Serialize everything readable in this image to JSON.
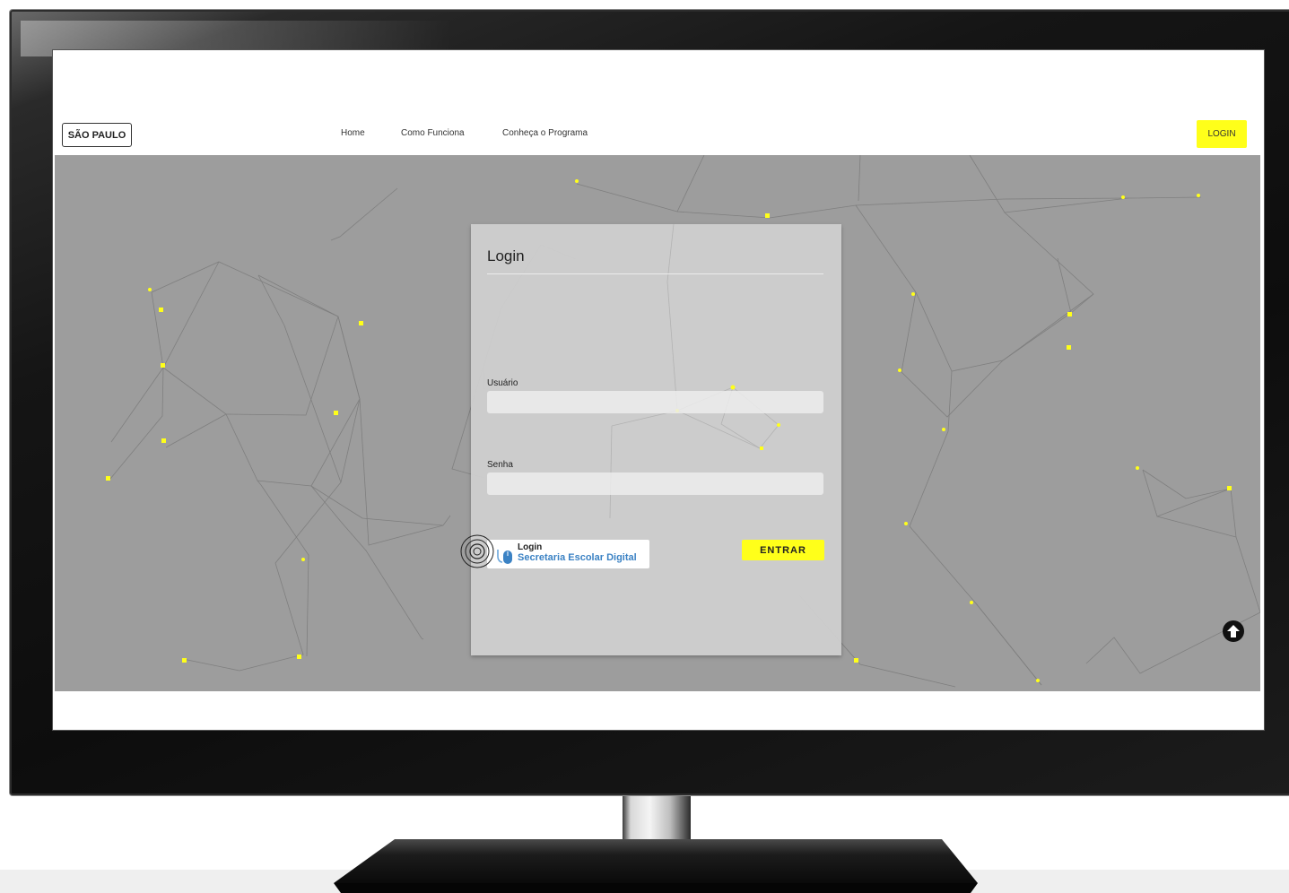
{
  "brand": {
    "label": "SÃO PAULO"
  },
  "nav": {
    "links": [
      "Home",
      "Como Funciona",
      "Conheça o Programa"
    ],
    "login_label": "LOGIN"
  },
  "login_card": {
    "title": "Login",
    "username_label": "Usuário",
    "password_label": "Senha",
    "sed_login": {
      "small_label": "Login",
      "big_label": "Secretaria Escolar Digital"
    },
    "submit_label": "ENTRAR"
  },
  "icons": {
    "scroll_top": "arrow-up-circle-icon",
    "sed": "mouse-hand-icon",
    "focus": "concentric-circles-icon"
  },
  "colors": {
    "accent_yellow": "#ffff1a",
    "hero_gray": "#9d9d9d",
    "card_gray": "#d0d0d0",
    "sed_blue": "#3b82c4"
  }
}
